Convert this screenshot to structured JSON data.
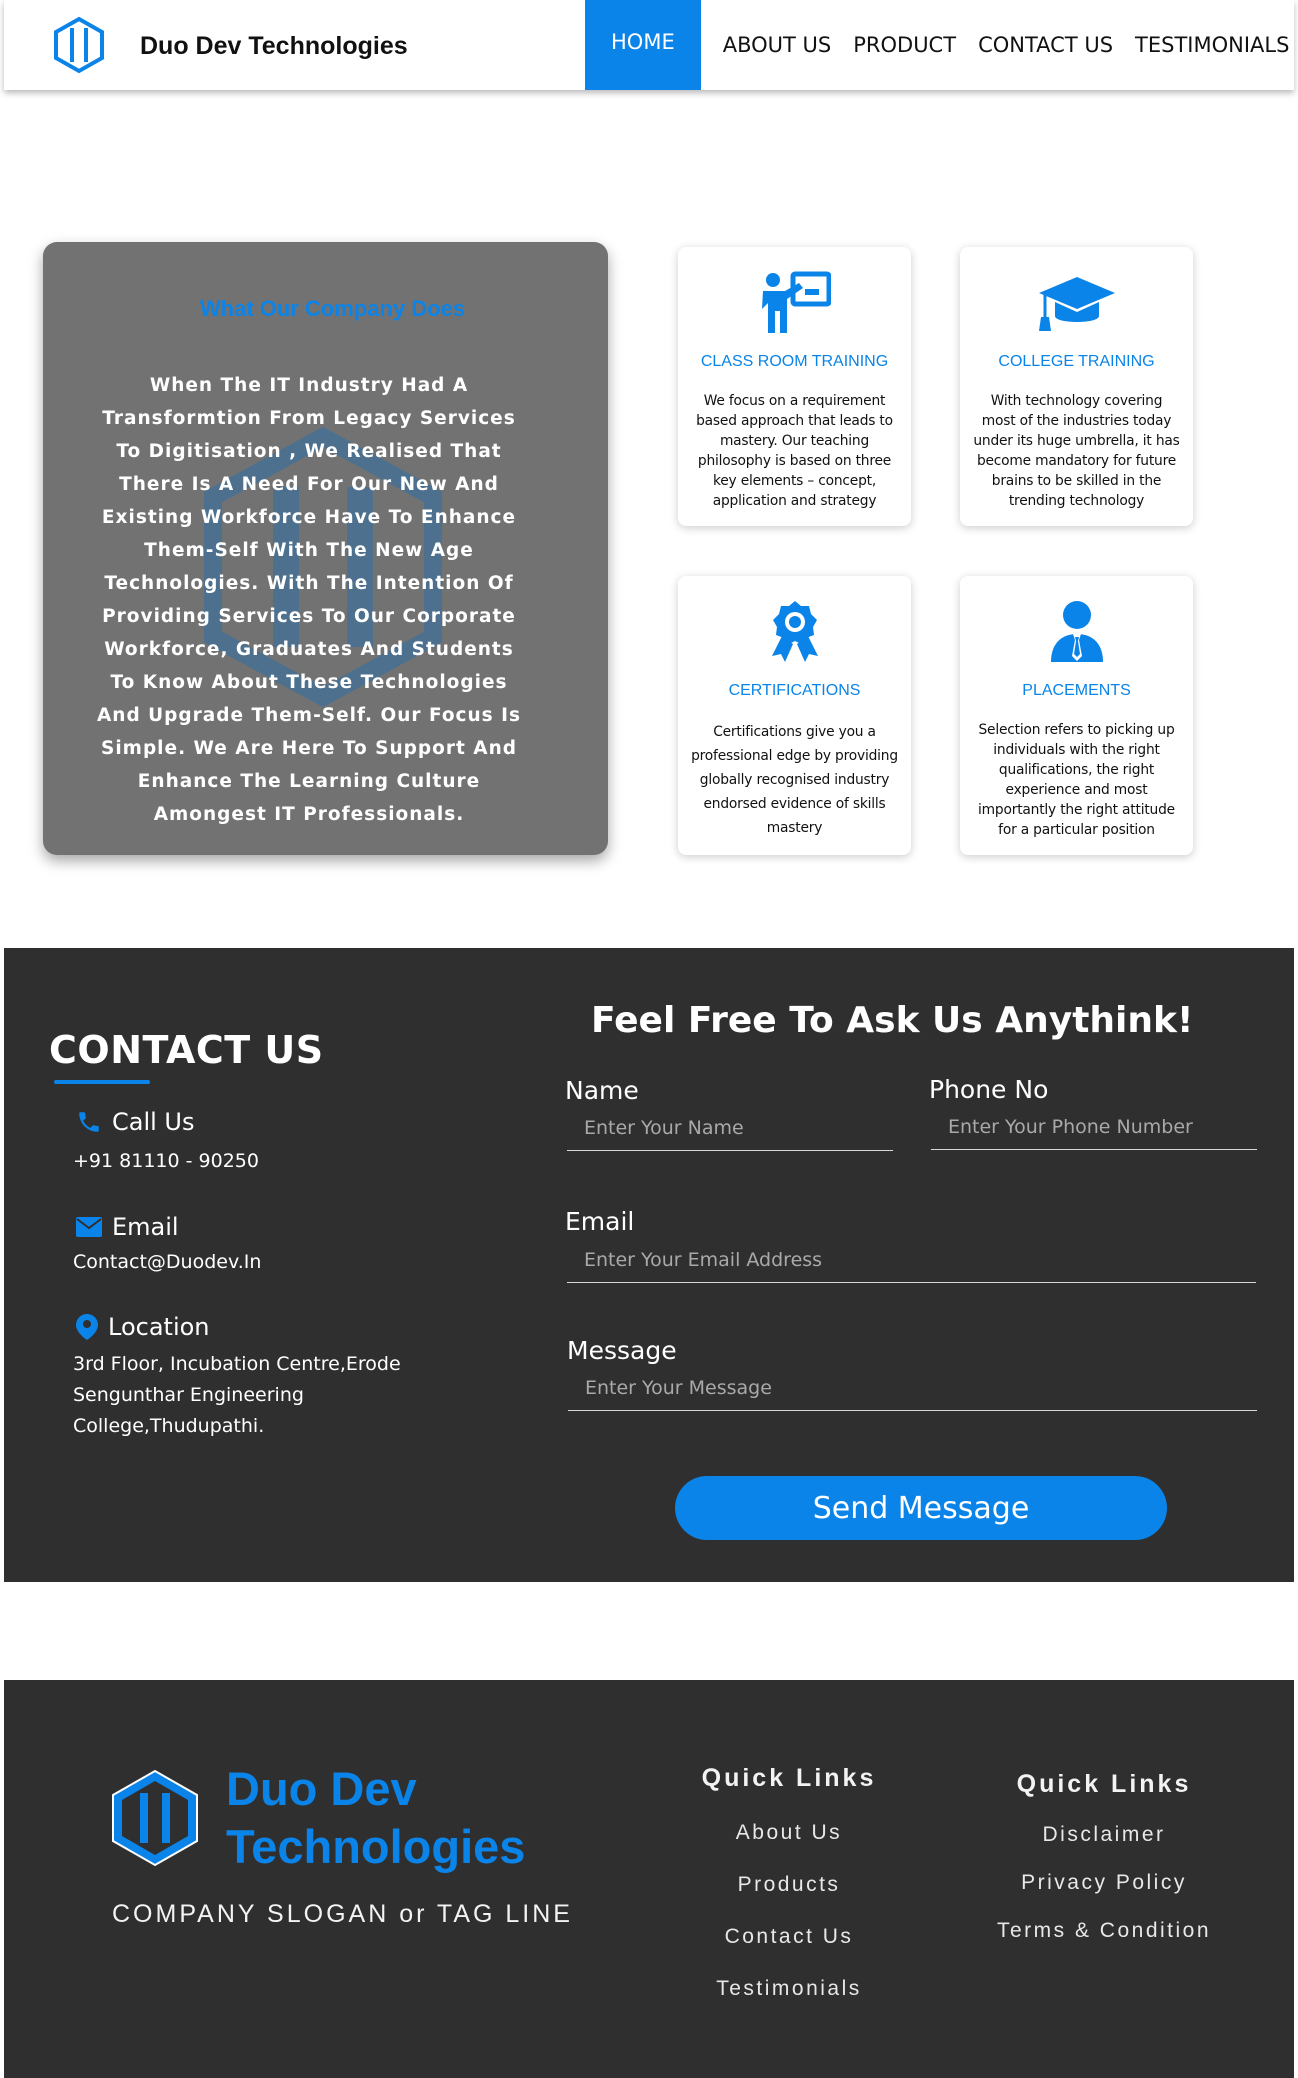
{
  "nav": {
    "brand": "Duo Dev Technologies",
    "items": [
      {
        "label": "HOME",
        "active": true
      },
      {
        "label": "ABOUT US",
        "active": false
      },
      {
        "label": "PRODUCT",
        "active": false
      },
      {
        "label": "CONTACT US",
        "active": false
      },
      {
        "label": "TESTIMONIALS",
        "active": false
      }
    ]
  },
  "about": {
    "title": "What Our Company Does",
    "body": "When The IT Industry Had A Transformtion From Legacy Services To Digitisation , We Realised That There Is A Need For Our New And Existing Workforce Have To Enhance Them-Self With The New Age Technologies. With The Intention Of Providing Services To Our Corporate Workforce, Graduates And Students To Know About These Technologies And Upgrade Them-Self. Our Focus Is Simple. We Are Here To Support And Enhance The Learning Culture Amongest IT Professionals."
  },
  "services": [
    {
      "title": "CLASS ROOM TRAINING",
      "icon": "teacher-board-icon",
      "text": "We focus on a requirement based approach that leads to mastery. Our teaching philosophy is based on three key elements – concept, application and strategy"
    },
    {
      "title": "COLLEGE TRAINING",
      "icon": "graduation-cap-icon",
      "text": "With technology covering most of the industries today under its huge umbrella, it has become mandatory for future brains to be skilled in the trending technology"
    },
    {
      "title": "CERTIFICATIONS",
      "icon": "award-ribbon-icon",
      "text": "Certifications give you a professional edge by providing globally recognised industry endorsed evidence of skills mastery"
    },
    {
      "title": "PLACEMENTS",
      "icon": "user-tie-icon",
      "text": "Selection refers to picking up individuals with the right qualifications, the right experience and most importantly the right attitude for a particular position"
    }
  ],
  "contact": {
    "heading": "CONTACT US",
    "call_label": "Call Us",
    "call_value": "+91 81110 - 90250",
    "email_label": "Email",
    "email_value": "Contact@Duodev.In",
    "location_label": "Location",
    "location_value": "3rd Floor, Incubation Centre,Erode Sengunthar Engineering College,Thudupathi.",
    "form_title": "Feel Free To Ask Us Anythink!",
    "name_label": "Name",
    "name_placeholder": "Enter Your Name",
    "phone_label": "Phone No",
    "phone_placeholder": "Enter Your Phone Number",
    "email_field_label": "Email",
    "email_placeholder": "Enter Your Email Address",
    "message_label": "Message",
    "message_placeholder": "Enter Your Message",
    "send_label": "Send Message"
  },
  "footer": {
    "brand_line1": "Duo Dev",
    "brand_line2": "Technologies",
    "slogan": "COMPANY SLOGAN or TAG LINE",
    "quick_links_1": {
      "title": "Quick Links",
      "links": [
        "About Us",
        "Products",
        "Contact Us",
        "Testimonials"
      ]
    },
    "quick_links_2": {
      "title": "Quick Links",
      "links": [
        "Disclaimer",
        "Privacy Policy",
        "Terms & Condition"
      ]
    }
  },
  "colors": {
    "accent": "#0a84e8",
    "dark_bg": "#2f2f2f",
    "panel_gray": "#727272"
  }
}
